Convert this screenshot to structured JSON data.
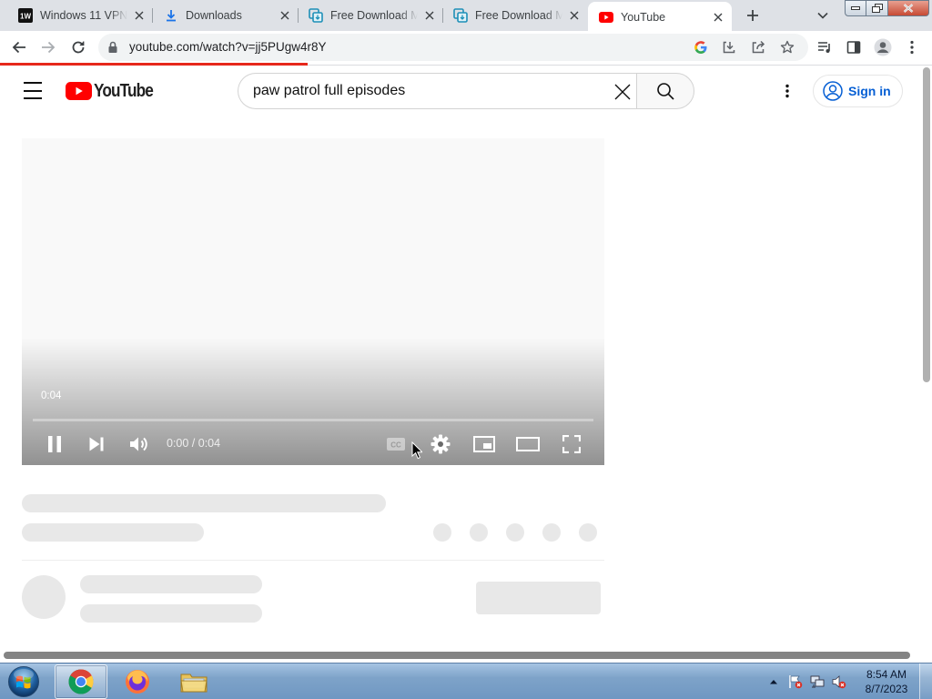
{
  "browser": {
    "tabs": [
      {
        "title": "Windows 11 VPN",
        "favicon": "1w-icon",
        "active": false
      },
      {
        "title": "Downloads",
        "favicon": "download-icon",
        "active": false
      },
      {
        "title": "Free Download Manager",
        "favicon": "fdm-icon",
        "active": false
      },
      {
        "title": "Free Download Manager",
        "favicon": "fdm-icon",
        "active": false
      },
      {
        "title": "YouTube",
        "favicon": "youtube-icon",
        "active": true
      }
    ],
    "favicon_1w_text": "1W",
    "url": "youtube.com/watch?v=jj5PUgw4r8Y",
    "load_progress_fraction": 0.33,
    "accent_color": "#e6281b"
  },
  "youtube": {
    "logo_text": "YouTube",
    "search_query": "paw patrol full episodes",
    "sign_in_label": "Sign in",
    "brand_red": "#ff0000",
    "link_blue": "#065fd4"
  },
  "player": {
    "hover_time": "0:04",
    "time_display": "0:00 / 0:04",
    "played_fraction": 0.0,
    "state": "playing"
  },
  "taskbar": {
    "clock_time": "8:54 AM",
    "clock_date": "8/7/2023",
    "apps": [
      "chrome-icon",
      "firefox-icon",
      "file-explorer-icon"
    ]
  }
}
